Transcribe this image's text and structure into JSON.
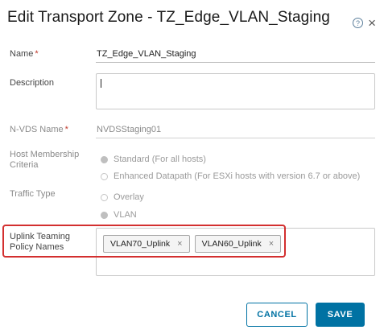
{
  "dialog": {
    "title": "Edit Transport Zone - TZ_Edge_VLAN_Staging",
    "help_icon": "question-circle-icon",
    "help_glyph": "?",
    "close_icon": "close-icon",
    "close_glyph": "×"
  },
  "form": {
    "name": {
      "label": "Name",
      "required_mark": "*",
      "value": "TZ_Edge_VLAN_Staging"
    },
    "description": {
      "label": "Description",
      "value": ""
    },
    "nvds_name": {
      "label": "N-VDS Name",
      "required_mark": "*",
      "value": "NVDSStaging01"
    },
    "host_membership": {
      "label": "Host Membership Criteria",
      "options": [
        {
          "label": "Standard (For all hosts)",
          "checked": true
        },
        {
          "label": "Enhanced Datapath (For ESXi hosts with version 6.7 or above)",
          "checked": false
        }
      ]
    },
    "traffic_type": {
      "label": "Traffic Type",
      "options": [
        {
          "label": "Overlay",
          "checked": false
        },
        {
          "label": "VLAN",
          "checked": true
        }
      ]
    },
    "uplink_teaming": {
      "label": "Uplink Teaming Policy Names",
      "tags": [
        {
          "label": "VLAN70_Uplink",
          "remove": "×"
        },
        {
          "label": "VLAN60_Uplink",
          "remove": "×"
        }
      ]
    }
  },
  "footer": {
    "cancel_label": "CANCEL",
    "save_label": "SAVE"
  },
  "colors": {
    "accent": "#0072a3",
    "highlight": "#d32f2f",
    "required": "#c0392b"
  }
}
